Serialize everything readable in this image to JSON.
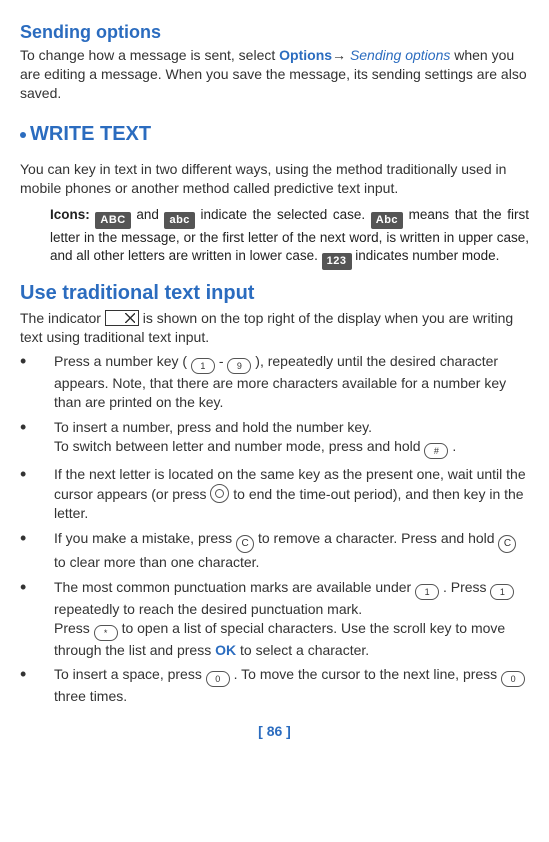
{
  "headings": {
    "sending_options": "Sending options",
    "write_text": "WRITE TEXT",
    "use_traditional": "Use traditional text input"
  },
  "inline": {
    "options": "Options",
    "sending_options": "Sending options",
    "icons_label": "Icons:",
    "ok": "OK"
  },
  "paragraphs": {
    "sending_pre": "To change how a message is sent, select ",
    "sending_mid": " when you are editing a message. When you save the message, its sending settings are also saved.",
    "write_intro": "You can key in text in two different ways, using the method traditionally used in mobile phones or another method called predictive text input.",
    "icons_1": " and ",
    "icons_2": " indicate the selected case. ",
    "icons_3": " means that the first letter in the message, or the first letter of the next word, is written in upper case, and all other letters are written in lower case. ",
    "icons_4": " indicates number mode.",
    "indicator_pre": "The indicator ",
    "indicator_post": " is shown on the top right of the display when you are writing text using traditional text input."
  },
  "icon_labels": {
    "ABC": "ABC",
    "abc": "abc",
    "Abc": "Abc",
    "123": "123"
  },
  "bullets": {
    "b1_pre": "Press a number key ( ",
    "b1_mid": " - ",
    "b1_post": " ), repeatedly until the desired character appears. Note, that there are more characters available for a number key than are printed on the key.",
    "b2a": "To insert a number, press and hold the number key.",
    "b2b_pre": "To switch between letter and number mode, press and hold ",
    "b2b_post": " .",
    "b3_pre": "If the next letter is located on the same key as the present one, wait until the cursor appears (or press ",
    "b3_post": " to end the time-out period), and then key in the letter.",
    "b4_pre": "If you make a mistake, press ",
    "b4_mid": " to remove a character. Press and hold ",
    "b4_post": " to clear more than one character.",
    "b5_pre": "The most common punctuation marks are available under ",
    "b5_mid": " . Press ",
    "b5_post": " repeatedly to reach the desired punctuation mark.",
    "b5b_pre": "Press ",
    "b5b_mid": " to open a list of special characters. Use the scroll key to move through the list and press ",
    "b5b_post": " to select a character.",
    "b6_pre": "To insert a space, press ",
    "b6_mid": " . To move the cursor to the next line, press ",
    "b6_post": " three times."
  },
  "keys": {
    "one": "1",
    "nine": "9",
    "hash": "#",
    "c": "C",
    "star": "*",
    "zero": "0"
  },
  "page_number": "[ 86 ]"
}
